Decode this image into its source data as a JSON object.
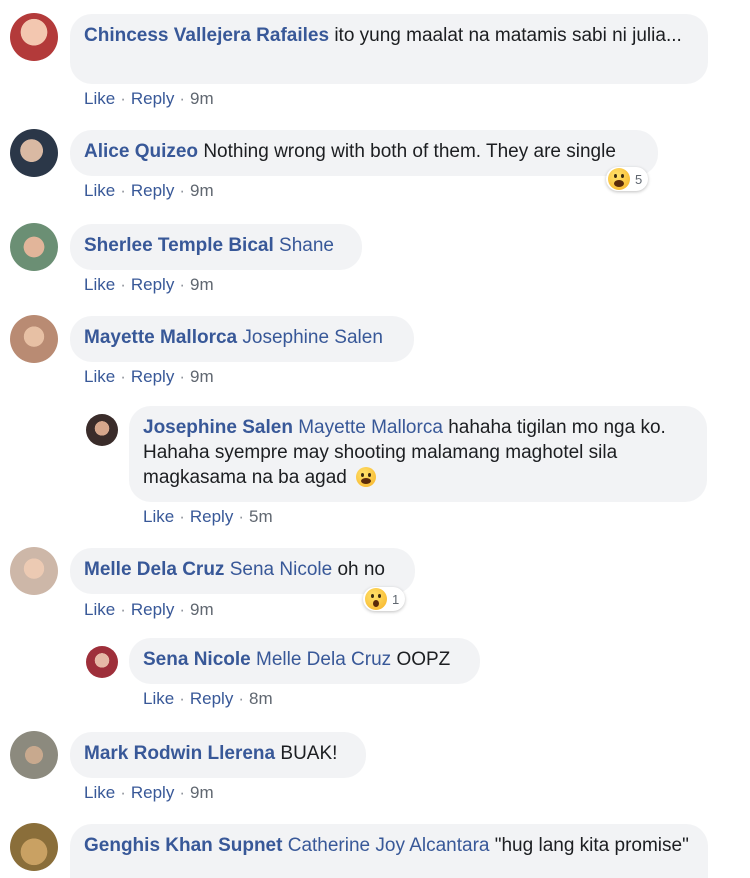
{
  "actions": {
    "like": "Like",
    "reply": "Reply",
    "sep": "·"
  },
  "comments": [
    {
      "author": "Chincess Vallejera Rafailes",
      "text": "ito yung maalat na matamis sabi ni julia...",
      "time": "9m"
    },
    {
      "author": "Alice Quizeo",
      "text": "Nothing wrong with both of them. They are single",
      "time": "9m",
      "reaction": {
        "icon": "haha-emoji-icon",
        "count": "5"
      }
    },
    {
      "author": "Sherlee Temple Bical",
      "tag": "Shane",
      "time": "9m"
    },
    {
      "author": "Mayette Mallorca",
      "tag": "Josephine Salen",
      "time": "9m"
    },
    {
      "author": "Josephine Salen",
      "tag": "Mayette Mallorca",
      "text": "hahaha tigilan mo nga ko. Hahaha syempre may shooting malamang maghotel sila magkasama na ba agad",
      "emoji": "tears-of-joy-emoji-icon",
      "time": "5m",
      "reply": true
    },
    {
      "author": "Melle Dela Cruz",
      "tag": "Sena Nicole",
      "text": "oh no",
      "time": "9m",
      "reaction": {
        "icon": "wow-emoji-icon",
        "count": "1"
      }
    },
    {
      "author": "Sena Nicole",
      "tag": "Melle Dela Cruz",
      "text": "OOPZ",
      "time": "8m",
      "reply": true
    },
    {
      "author": "Mark Rodwin Llerena",
      "text": "BUAK!",
      "time": "9m"
    },
    {
      "author": "Genghis Khan Supnet",
      "tag": "Catherine Joy Alcantara",
      "text": "\"hug lang kita promise\""
    }
  ],
  "colors": {
    "link": "#385898",
    "bubble": "#f2f3f5",
    "time": "#606770"
  }
}
